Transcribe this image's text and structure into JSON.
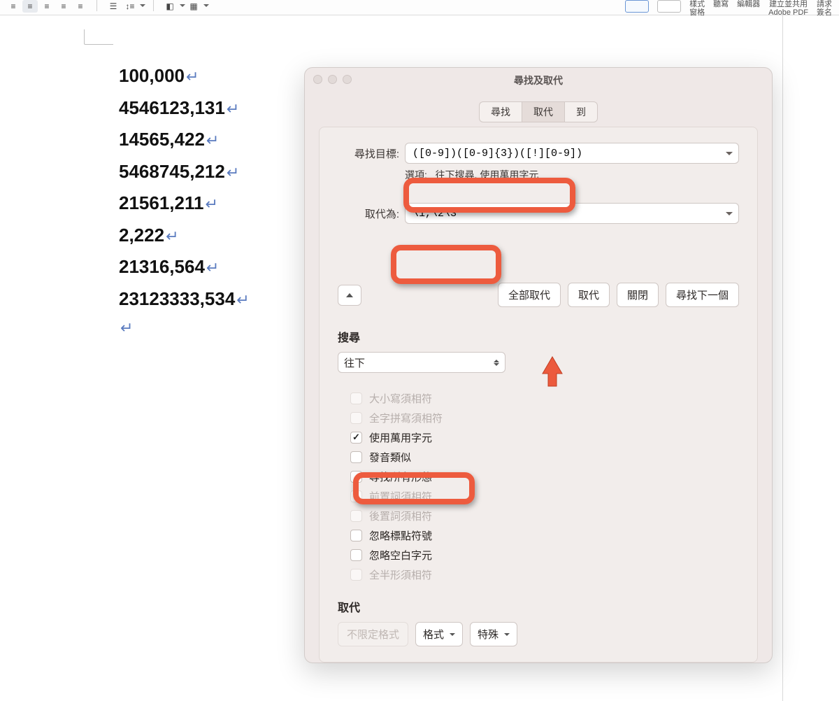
{
  "toolbar": {
    "right_labels": {
      "slot1": "",
      "slot2": "",
      "panes": "樣式\n窗格",
      "dictation": "聽寫",
      "editor": "編輯器",
      "create": "建立並共用\nAdobe PDF",
      "signature": "請求\n簽名"
    }
  },
  "document": {
    "lines": [
      "100,000",
      "4546123,131",
      "14565,422",
      "5468745,212",
      "21561,211",
      "2,222",
      "21316,564",
      "23123333,534"
    ]
  },
  "dialog": {
    "title": "尋找及取代",
    "tabs": {
      "find": "尋找",
      "replace": "取代",
      "goto": "到"
    },
    "find_label": "尋找目標:",
    "find_value": "([0-9])([0-9]{3})([!][0-9])",
    "options_label": "選項:",
    "options_value": "往下搜尋, 使用萬用字元",
    "replace_label": "取代為:",
    "replace_value": "\\1,\\2\\3",
    "buttons": {
      "replace_all": "全部取代",
      "replace": "取代",
      "close": "關閉",
      "find_next": "尋找下一個"
    },
    "search_section": "搜尋",
    "search_direction": "往下",
    "checks": {
      "match_case": "大小寫須相符",
      "whole_word": "全字拼寫須相符",
      "wildcards": "使用萬用字元",
      "sounds_like": "發音類似",
      "all_forms": "尋找所有形態",
      "prefix": "前置詞須相符",
      "suffix": "後置詞須相符",
      "ignore_punct": "忽略標點符號",
      "ignore_space": "忽略空白字元",
      "full_half": "全半形須相符"
    },
    "replace_section": "取代",
    "replace_buttons": {
      "no_format": "不限定格式",
      "format": "格式",
      "special": "特殊"
    }
  }
}
